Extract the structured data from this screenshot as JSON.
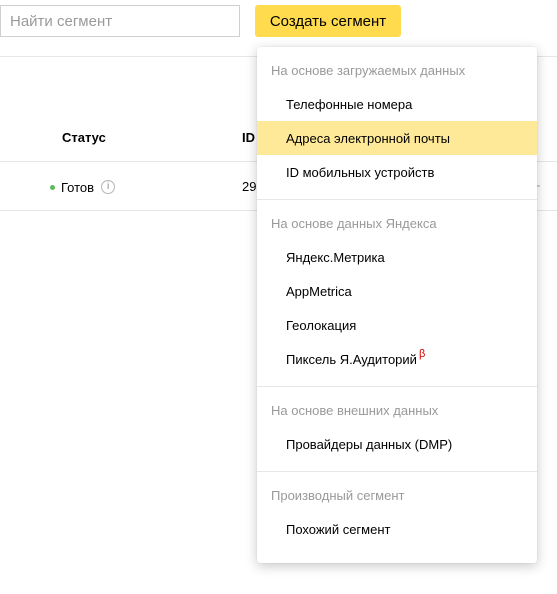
{
  "toolbar": {
    "search_placeholder": "Найти сегмент",
    "create_label": "Создать сегмент"
  },
  "table": {
    "columns": {
      "status": "Статус",
      "id": "ID"
    },
    "rows": [
      {
        "status": "Готов",
        "id_partial": "29"
      }
    ]
  },
  "dropdown": {
    "groups": [
      {
        "title": "На основе загружаемых данных",
        "items": [
          {
            "label": "Телефонные номера"
          },
          {
            "label": "Адреса электронной почты",
            "highlighted": true
          },
          {
            "label": "ID мобильных устройств"
          }
        ]
      },
      {
        "title": "На основе данных Яндекса",
        "items": [
          {
            "label": "Яндекс.Метрика"
          },
          {
            "label": "AppMetrica"
          },
          {
            "label": "Геолокация"
          },
          {
            "label": "Пиксель Я.Аудиторий",
            "badge": "β"
          }
        ]
      },
      {
        "title": "На основе внешних данных",
        "items": [
          {
            "label": "Провайдеры данных (DMP)"
          }
        ]
      },
      {
        "title": "Производный сегмент",
        "items": [
          {
            "label": "Похожий сегмент"
          }
        ]
      }
    ]
  },
  "colors": {
    "accent": "#ffdb4d",
    "highlight": "#fee998",
    "status_ready": "#5cb85c",
    "beta": "#d50000"
  },
  "icons": {
    "status": "status-dot-icon",
    "info": "info-icon"
  }
}
